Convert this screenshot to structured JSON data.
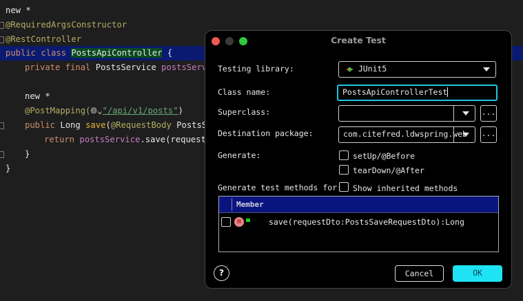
{
  "editor": {
    "lines": [
      {
        "text": "new *"
      },
      {
        "text": "@RequiredArgsConstructor"
      },
      {
        "text": "@RestController"
      },
      {
        "kw": "public class ",
        "name": "PostsApiController",
        "rest": " {"
      },
      {
        "kw": "private final ",
        "type": "PostsService ",
        "field": "postsServi"
      },
      {
        "text": "new *"
      },
      {
        "ann": "@PostMapping(",
        "icon": "globe-icon",
        "str": "\"/api/v1/posts\"",
        "end": ")"
      },
      {
        "kw": "public ",
        "type": "Long ",
        "fn": "save",
        "rest": "(",
        "ann": "@RequestBody ",
        "type2": "PostsSa"
      },
      {
        "kw": "return ",
        "field": "postsService",
        "rest": ".save(requestD"
      },
      {
        "text": "}"
      },
      {
        "text": "}"
      }
    ]
  },
  "dialog": {
    "title": "Create Test",
    "testing_library_label": "Testing library:",
    "testing_library_value": "JUnit5",
    "class_name_label": "Class name:",
    "class_name_value": "PostsApiControllerTest",
    "superclass_label": "Superclass:",
    "superclass_value": "",
    "destination_label": "Destination package:",
    "destination_value": "com.citefred.ldwspring.web",
    "browse_label": "...",
    "generate_label": "Generate:",
    "setup_label": "setUp/@Before",
    "teardown_label": "tearDown/@After",
    "methods_label": "Generate test methods for:",
    "inherited_label": "Show inherited methods",
    "table_header": "Member",
    "members": [
      {
        "badge": "m",
        "signature": "save(requestDto:PostsSaveRequestDto):Long",
        "checked": false
      }
    ],
    "help_label": "?",
    "cancel_label": "Cancel",
    "ok_label": "OK",
    "accent": "#1ee3f5"
  }
}
